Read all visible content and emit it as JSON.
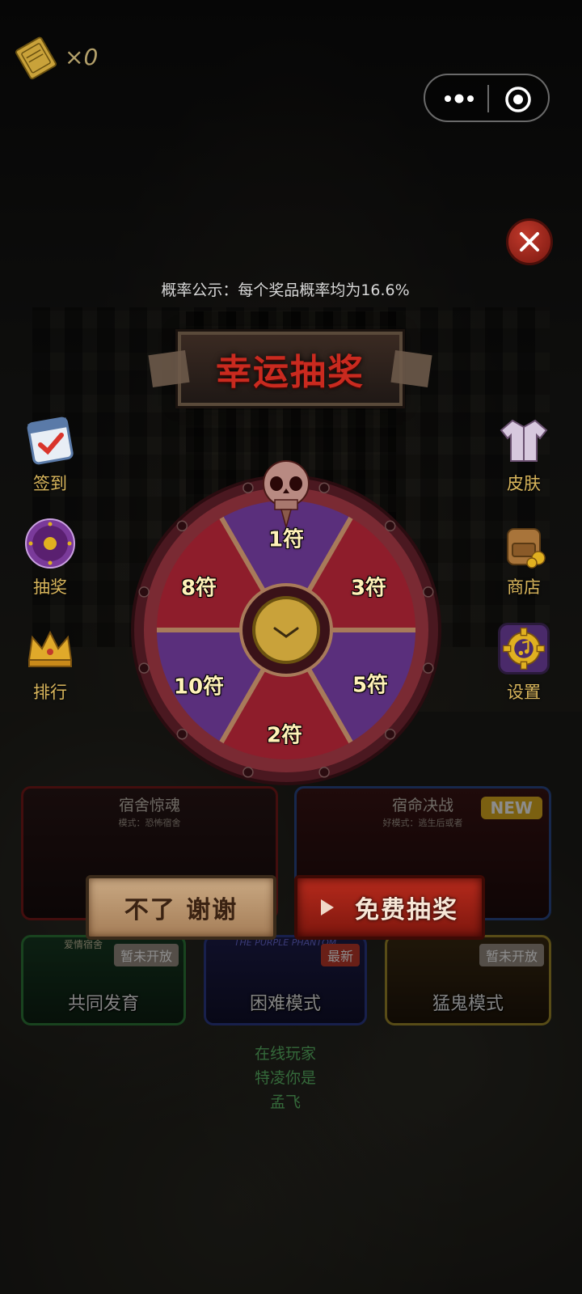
{
  "ticket": {
    "count": "×0"
  },
  "probability_notice": "概率公示：每个奖品概率均为16.6%",
  "title": "幸运抽奖",
  "left_menu": [
    {
      "label": "签到",
      "icon": "checkin-calendar-icon"
    },
    {
      "label": "抽奖",
      "icon": "lottery-wheel-icon"
    },
    {
      "label": "排行",
      "icon": "crown-icon"
    }
  ],
  "right_menu": [
    {
      "label": "皮肤",
      "icon": "jacket-icon"
    },
    {
      "label": "商店",
      "icon": "backpack-icon"
    },
    {
      "label": "设置",
      "icon": "gear-music-icon"
    }
  ],
  "wheel": {
    "prizes": [
      "1符",
      "3符",
      "5符",
      "2符",
      "10符",
      "8符"
    ],
    "colors": {
      "red": "#8e1d2b",
      "purple": "#5a2f7c",
      "rim": "#6b2a33"
    }
  },
  "cards_top": [
    {
      "title": "宿舍惊魂",
      "subtitle": "模式：恐怖宿舍"
    },
    {
      "title": "宿命决战",
      "subtitle": "好模式：逃生后或者",
      "badge": "NEW"
    }
  ],
  "cards_bottom": [
    {
      "label": "共同发育",
      "badge": "暂未开放",
      "top_text": "爱情宿舍"
    },
    {
      "label": "困难模式",
      "badge": "最新",
      "top_text": "THE PURPLE PHANTOM"
    },
    {
      "label": "猛鬼模式",
      "badge": "暂未开放"
    }
  ],
  "buttons": {
    "decline": "不了 谢谢",
    "free_draw": "免费抽奖"
  },
  "online": {
    "line1": "在线玩家",
    "line2": "特凌你是",
    "line3": "孟飞"
  }
}
